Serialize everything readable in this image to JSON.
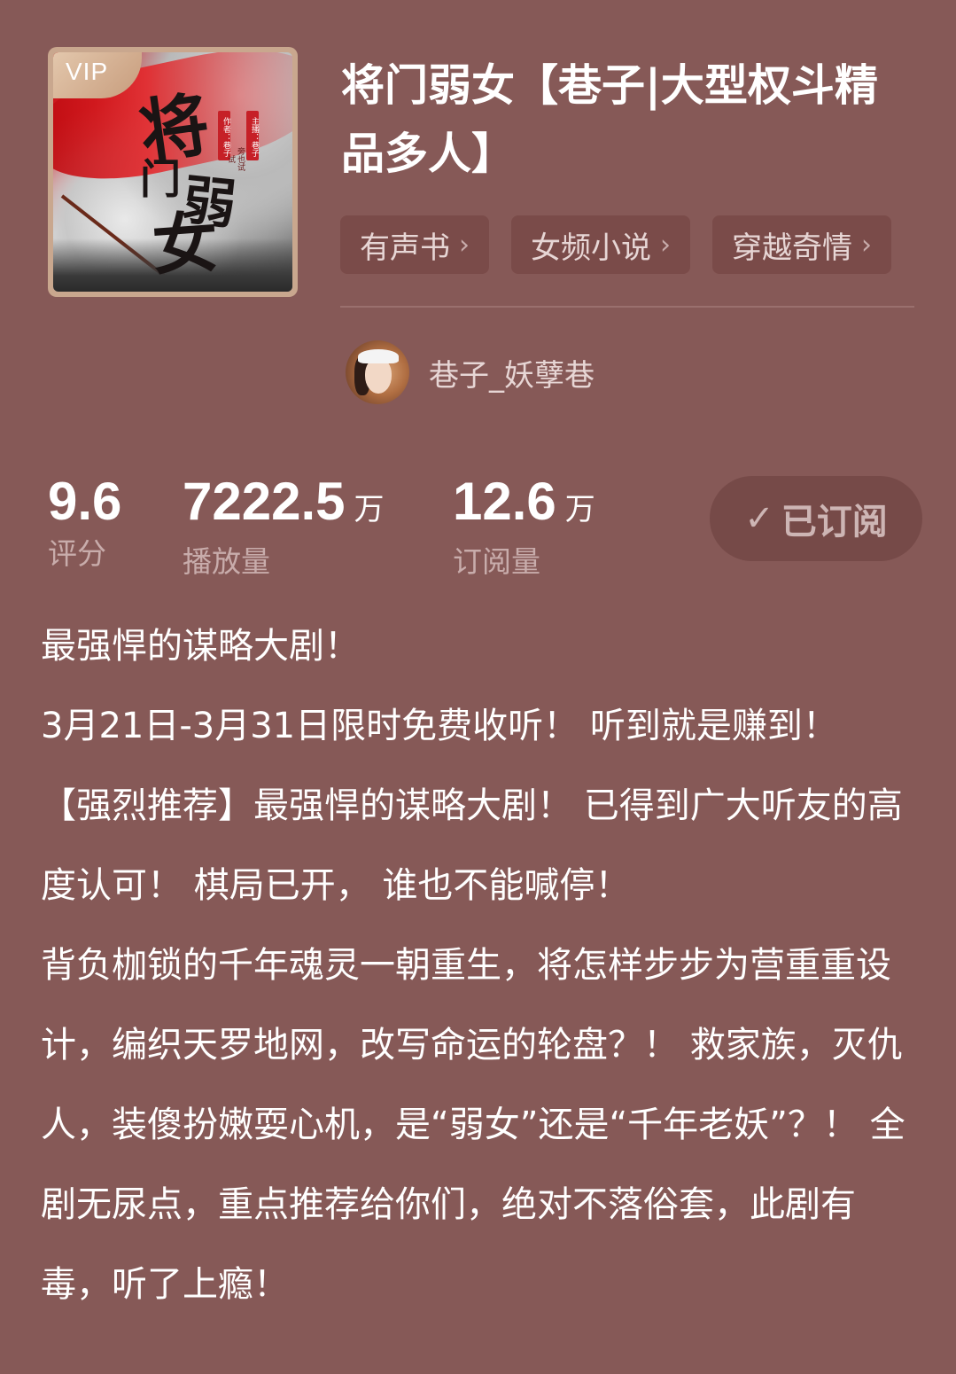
{
  "cover": {
    "vip_label": "VIP",
    "art_text": [
      "将",
      "门",
      "弱",
      "女"
    ],
    "seal_texts": [
      "作者：巷子",
      "主播：巷子",
      "旁也试试"
    ]
  },
  "book": {
    "title": "将门弱女【巷子|大型权斗精品多人】"
  },
  "tags": [
    {
      "label": "有声书"
    },
    {
      "label": "女频小说"
    },
    {
      "label": "穿越奇情"
    }
  ],
  "author": {
    "name": "巷子_妖孽巷"
  },
  "stats": {
    "rating": {
      "value": "9.6",
      "label": "评分"
    },
    "plays": {
      "value": "7222.5",
      "unit": "万",
      "label": "播放量"
    },
    "subscriptions": {
      "value": "12.6",
      "unit": "万",
      "label": "订阅量"
    }
  },
  "subscribe": {
    "label": "已订阅",
    "icon": "check-icon"
  },
  "description": {
    "lines": [
      "最强悍的谋略大剧！",
      "3月21日-3月31日限时免费收听！ 听到就是赚到！",
      "【强烈推荐】最强悍的谋略大剧！ 已得到广大听友的高度认可！ 棋局已开， 谁也不能喊停！",
      "背负枷锁的千年魂灵一朝重生，将怎样步步为营重重设计，编织天罗地网，改写命运的轮盘？！ 救家族，灭仇人，装傻扮嫩耍心机，是“弱女”还是“千年老妖”？！ 全剧无尿点，重点推荐给你们，绝对不落俗套，此剧有毒，听了上瘾！"
    ]
  },
  "colors": {
    "background": "#865957",
    "tag_bg": "#7a4b49",
    "muted_text": "#c8acab",
    "button_bg": "#764a48"
  }
}
